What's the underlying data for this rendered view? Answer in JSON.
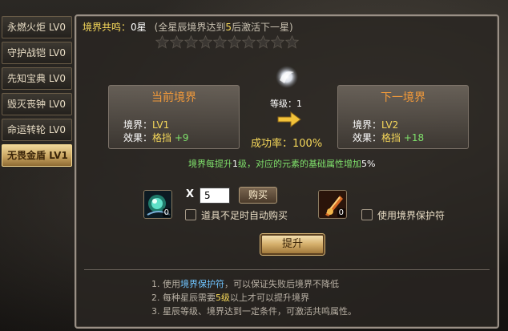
{
  "tabs": [
    {
      "label": "永燃火炬 LV0",
      "active": false
    },
    {
      "label": "守护战铠 LV0",
      "active": false
    },
    {
      "label": "先知宝典 LV0",
      "active": false
    },
    {
      "label": "毁灭丧钟 LV0",
      "active": false
    },
    {
      "label": "命运转轮 LV0",
      "active": false
    },
    {
      "label": "无畏金盾 LV1",
      "active": true
    }
  ],
  "resonance": {
    "label": "境界共鸣：",
    "value": "0星",
    "hint_prefix": "(全星辰境界达到",
    "hint_num": "5",
    "hint_suffix": "后激活下一星)",
    "stars_total": 10,
    "stars_lit": 0
  },
  "current": {
    "title": "当前境界",
    "realm_label": "境界：",
    "realm_value": "LV1",
    "effect_label": "效果：",
    "effect_name": "格挡",
    "effect_bonus": "+9"
  },
  "next": {
    "title": "下一境界",
    "realm_label": "境界：",
    "realm_value": "LV2",
    "effect_label": "效果：",
    "effect_name": "格挡",
    "effect_bonus": "+18"
  },
  "level_text": "等级：1",
  "success": {
    "label": "成功率：",
    "value": "100%"
  },
  "info": {
    "prefix": "境界每提升",
    "num": "1",
    "mid": "级，对应的元素的基础属性增加",
    "pct": "5%"
  },
  "buy": {
    "x_label": "X",
    "quantity": "5",
    "button": "购买",
    "auto_buy_label": "道具不足时自动购买",
    "material_count": "0"
  },
  "protect": {
    "label": "使用境界保护符",
    "count": "0"
  },
  "upgrade_button": "提升",
  "tips": {
    "t1_a": "1. 使用",
    "t1_b": "境界保护符",
    "t1_c": "，可以保证失败后境界不降低",
    "t2_a": "2. 每种星辰需要",
    "t2_b": "5级",
    "t2_c": "以上才可以提升境界",
    "t3": "3. 星辰等级、境界达到一定条件，可激活共鸣属性。"
  },
  "colors": {
    "gold": "#f6d85a",
    "green": "#7fe06b",
    "orange_title": "#f29a3a",
    "cyan_link": "#6fc4ff"
  }
}
